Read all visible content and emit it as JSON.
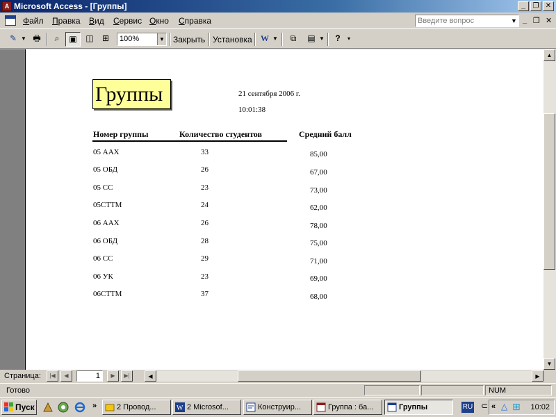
{
  "window": {
    "title": "Microsoft Access - [Группы]",
    "app_icon": "access-icon"
  },
  "menu": {
    "items": [
      "Файл",
      "Правка",
      "Вид",
      "Сервис",
      "Окно",
      "Справка"
    ],
    "help_placeholder": "Введите вопрос"
  },
  "toolbar": {
    "zoom": "100%",
    "close_label": "Закрыть",
    "setup_label": "Установка"
  },
  "report": {
    "title": "Группы",
    "date": "21 сентября 2006 г.",
    "time": "10:01:38",
    "headers": [
      "Номер группы",
      "Количество студентов",
      "Средний балл"
    ],
    "rows": [
      {
        "group": "05 ААХ",
        "count": "33",
        "avg": "85,00"
      },
      {
        "group": "05 ОБД",
        "count": "26",
        "avg": "67,00"
      },
      {
        "group": "05 СС",
        "count": "23",
        "avg": "73,00"
      },
      {
        "group": "05СТТМ",
        "count": "24",
        "avg": "62,00"
      },
      {
        "group": "06 ААХ",
        "count": "26",
        "avg": "78,00"
      },
      {
        "group": "06 ОБД",
        "count": "28",
        "avg": "75,00"
      },
      {
        "group": "06 СС",
        "count": "29",
        "avg": "71,00"
      },
      {
        "group": "06 УК",
        "count": "23",
        "avg": "69,00"
      },
      {
        "group": "06СТТМ",
        "count": "37",
        "avg": "68,00"
      }
    ]
  },
  "navigation": {
    "label": "Страница:",
    "page": "1"
  },
  "status": {
    "text": "Готово",
    "num": "NUM"
  },
  "taskbar": {
    "start": "Пуск",
    "tasks": [
      "2 Провод...",
      "2 Microsof...",
      "Конструир...",
      "Группа : ба...",
      "Группы"
    ],
    "lang": "RU",
    "clock": "10:02"
  }
}
